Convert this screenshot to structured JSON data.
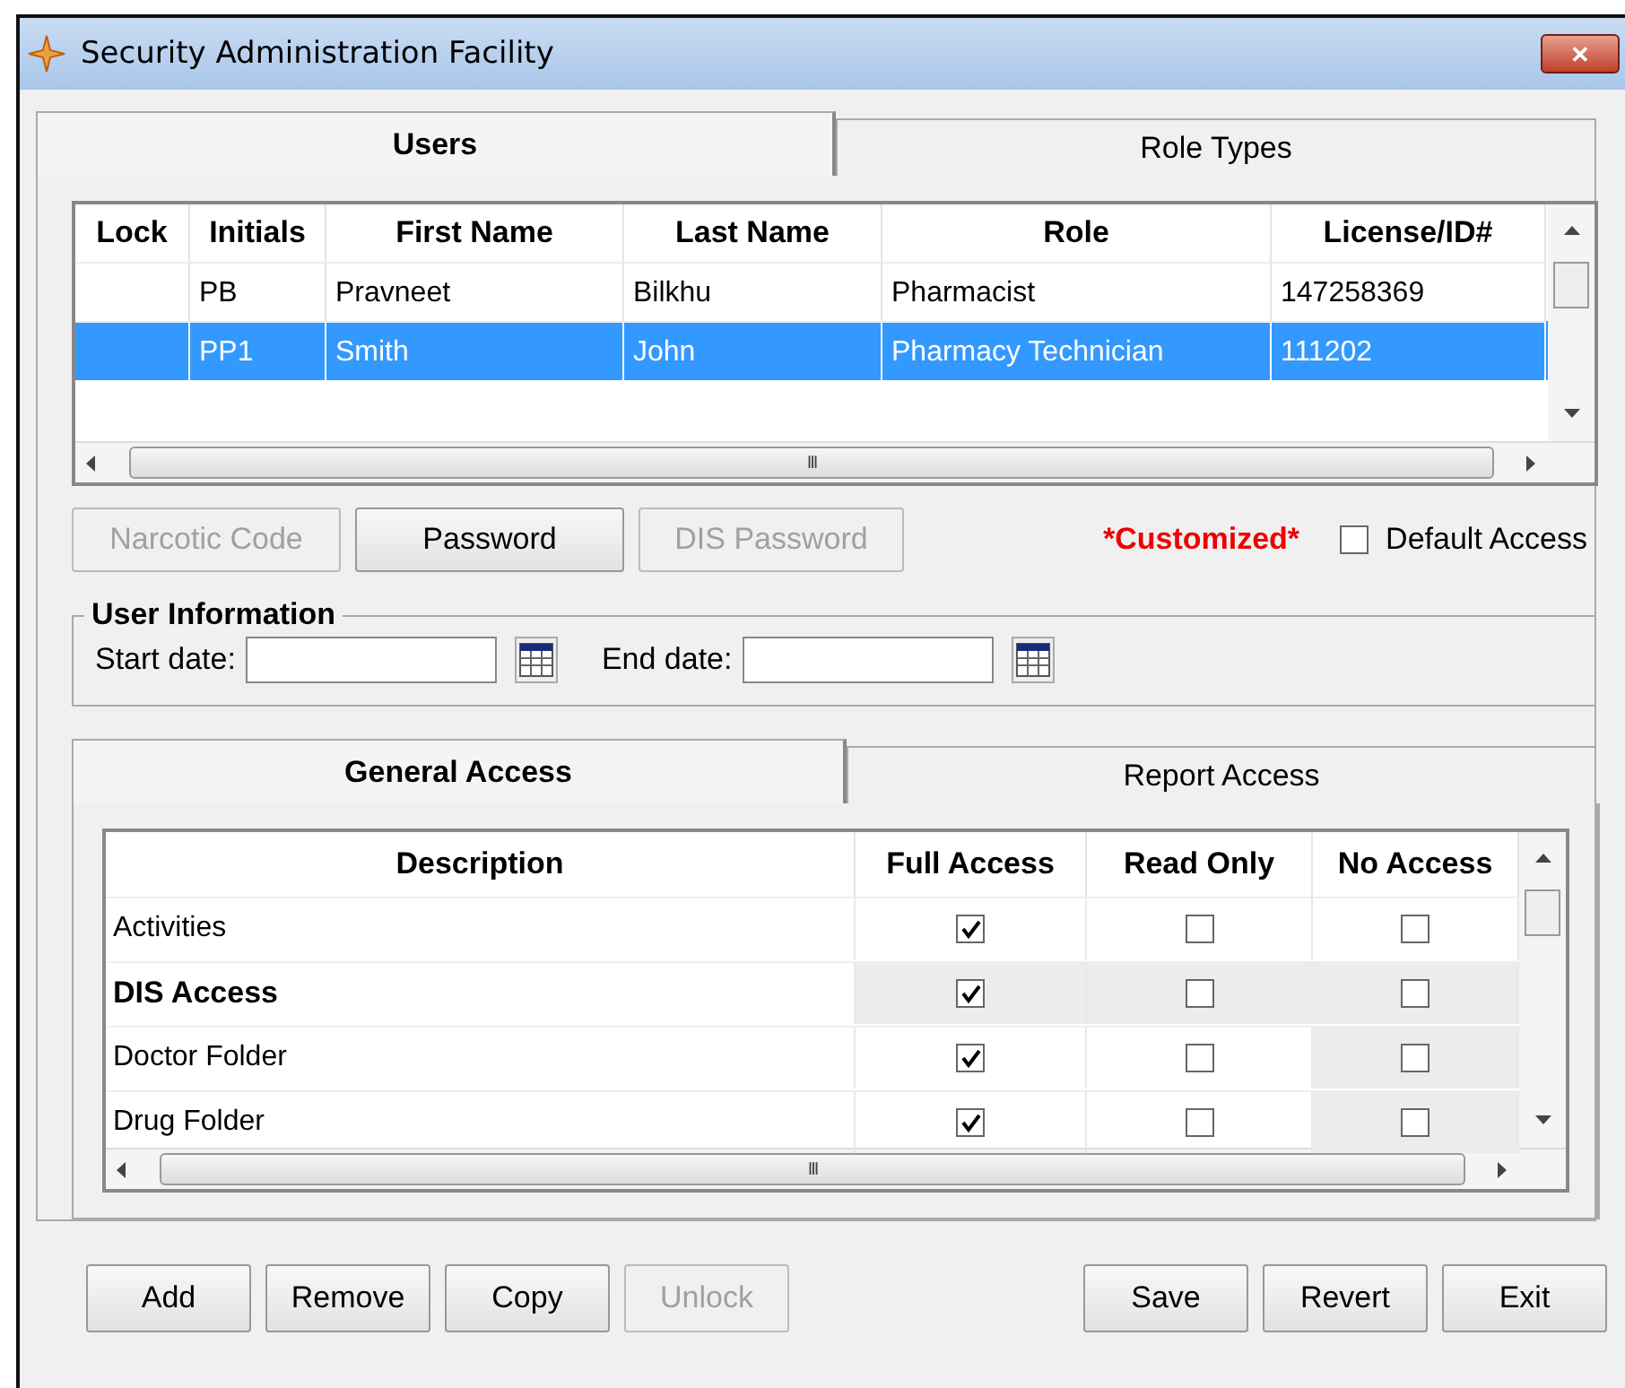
{
  "window": {
    "title": "Security Administration Facility",
    "close": "✕"
  },
  "tabs": [
    {
      "label": "Users",
      "selected": true
    },
    {
      "label": "Role Types",
      "selected": false
    }
  ],
  "users_table": {
    "columns": [
      "Lock",
      "Initials",
      "First Name",
      "Last Name",
      "Role",
      "License/ID#"
    ],
    "rows": [
      {
        "selected": false,
        "cells": [
          "",
          "PB",
          "Pravneet",
          "Bilkhu",
          "Pharmacist",
          "147258369"
        ]
      },
      {
        "selected": true,
        "cells": [
          "",
          "PP1",
          "Smith",
          "John",
          "Pharmacy Technician",
          "111202"
        ]
      }
    ],
    "hscroll_grip": "III"
  },
  "user_buttons": [
    {
      "label": "Narcotic Code",
      "disabled": true
    },
    {
      "label": "Password",
      "disabled": false
    },
    {
      "label": "DIS Password",
      "disabled": true
    }
  ],
  "customized": "*Customized*",
  "default_access": {
    "label": "Default Access",
    "checked": false
  },
  "user_information": {
    "title": "User Information",
    "start_label": "Start date:",
    "end_label": "End date:"
  },
  "access_tabs": [
    {
      "label": "General Access",
      "selected": true
    },
    {
      "label": "Report Access",
      "selected": false
    }
  ],
  "access_table": {
    "columns": [
      "Description",
      "Full Access",
      "Read Only",
      "No Access"
    ],
    "rows": [
      {
        "description": "Activities",
        "bold": false,
        "cells": [
          {
            "checked": true,
            "shaded": false
          },
          {
            "checked": false,
            "shaded": false
          },
          {
            "checked": false,
            "shaded": false
          }
        ]
      },
      {
        "description": "DIS Access",
        "bold": true,
        "cells": [
          {
            "checked": true,
            "shaded": true
          },
          {
            "checked": false,
            "shaded": true
          },
          {
            "checked": false,
            "shaded": true
          }
        ]
      },
      {
        "description": "Doctor Folder",
        "bold": false,
        "cells": [
          {
            "checked": true,
            "shaded": false
          },
          {
            "checked": false,
            "shaded": false
          },
          {
            "checked": false,
            "shaded": true
          }
        ]
      },
      {
        "description": "Drug Folder",
        "bold": false,
        "cells": [
          {
            "checked": true,
            "shaded": false
          },
          {
            "checked": false,
            "shaded": false
          },
          {
            "checked": false,
            "shaded": true
          }
        ]
      }
    ],
    "hscroll_grip": "III"
  },
  "left_buttons": [
    {
      "label": "Add",
      "disabled": false
    },
    {
      "label": "Remove",
      "disabled": false
    },
    {
      "label": "Copy",
      "disabled": false
    },
    {
      "label": "Unlock",
      "disabled": true
    }
  ],
  "right_buttons": [
    {
      "label": "Save",
      "disabled": false
    },
    {
      "label": "Revert",
      "disabled": false
    },
    {
      "label": "Exit",
      "disabled": false
    }
  ]
}
